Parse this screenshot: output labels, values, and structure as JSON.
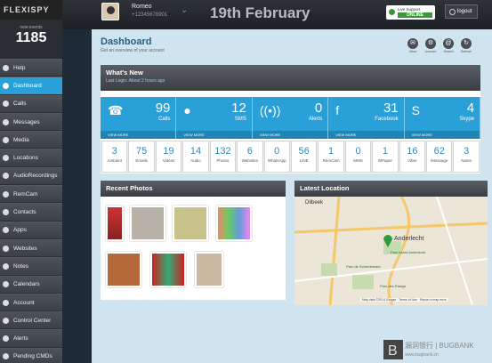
{
  "app": {
    "logo": "FLEXISPY",
    "events_label": "new events",
    "events_count": "1185"
  },
  "sidebar": {
    "items": [
      {
        "label": "Help",
        "icon": "info-icon"
      },
      {
        "label": "Dashboard",
        "icon": "dashboard-icon",
        "active": true
      },
      {
        "label": "Calls",
        "icon": "phone-icon"
      },
      {
        "label": "Messages",
        "icon": "message-icon"
      },
      {
        "label": "Media",
        "icon": "media-icon"
      },
      {
        "label": "Locations",
        "icon": "location-icon"
      },
      {
        "label": "AudioRecordings",
        "icon": "audio-icon"
      },
      {
        "label": "RemCam",
        "icon": "camera-icon"
      },
      {
        "label": "Contacts",
        "icon": "contacts-icon"
      },
      {
        "label": "Apps",
        "icon": "apps-icon"
      },
      {
        "label": "Websites",
        "icon": "link-icon"
      },
      {
        "label": "Notes",
        "icon": "notes-icon"
      },
      {
        "label": "Calendars",
        "icon": "calendar-icon"
      },
      {
        "label": "Account",
        "icon": "account-icon"
      },
      {
        "label": "Control Center",
        "icon": "control-icon"
      },
      {
        "label": "Alerts",
        "icon": "alert-icon"
      },
      {
        "label": "Pending CMDs",
        "icon": "pending-icon"
      }
    ]
  },
  "header": {
    "user_name": "Romeo",
    "user_phone": "+12345678901",
    "date": "19th February",
    "live_support": "Live Support",
    "live_status": "ONLINE",
    "logout": "logout"
  },
  "dashboard": {
    "title": "Dashboard",
    "subtitle": "Get an overview of your account",
    "toolbar": [
      {
        "label": "Inbox",
        "icon": "mail-icon"
      },
      {
        "label": "Account",
        "icon": "gear-icon"
      },
      {
        "label": "Search",
        "icon": "search-icon"
      },
      {
        "label": "Refresh",
        "icon": "refresh-icon"
      }
    ]
  },
  "whats_new": {
    "title": "What's New",
    "last_login": "Last Login: About 2 hours ago",
    "tiles": [
      {
        "count": "99",
        "label": "Calls",
        "icon": "phone-icon",
        "view": "VIEW MORE"
      },
      {
        "count": "12",
        "label": "SMS",
        "icon": "chat-bubble-icon",
        "view": "VIEW MORE"
      },
      {
        "count": "0",
        "label": "Alerts",
        "icon": "signal-icon",
        "view": "VIEW MORE"
      },
      {
        "count": "31",
        "label": "Facebook",
        "icon": "facebook-icon",
        "view": "VIEW MORE"
      },
      {
        "count": "4",
        "label": "Skype",
        "icon": "skype-icon",
        "view": "VIEW MORE"
      }
    ],
    "counts": [
      {
        "n": "3",
        "l": "Ambient"
      },
      {
        "n": "75",
        "l": "Emails"
      },
      {
        "n": "19",
        "l": "Videos"
      },
      {
        "n": "14",
        "l": "Audio"
      },
      {
        "n": "132",
        "l": "Photos"
      },
      {
        "n": "6",
        "l": "Websites"
      },
      {
        "n": "0",
        "l": "WhatsApp"
      },
      {
        "n": "56",
        "l": "LINE"
      },
      {
        "n": "1",
        "l": "RemCam"
      },
      {
        "n": "0",
        "l": "MMS"
      },
      {
        "n": "1",
        "l": "WPaper"
      },
      {
        "n": "16",
        "l": "Viber"
      },
      {
        "n": "62",
        "l": "iMessage"
      },
      {
        "n": "3",
        "l": "Notes"
      }
    ]
  },
  "recent_photos": {
    "title": "Recent Photos"
  },
  "latest_location": {
    "title": "Latest Location",
    "map_labels": [
      "Dilbeek",
      "Anderlecht",
      "Parc Astrid Anderlecht",
      "Parc de Scherdemael",
      "Parc des Etangs"
    ],
    "attribution": "Map data ©2014 Google",
    "terms": "Terms of Use",
    "report": "Report a map error"
  },
  "watermark": {
    "brand": "漏洞银行 | BUGBANK",
    "url": "www.bugbank.cn"
  }
}
